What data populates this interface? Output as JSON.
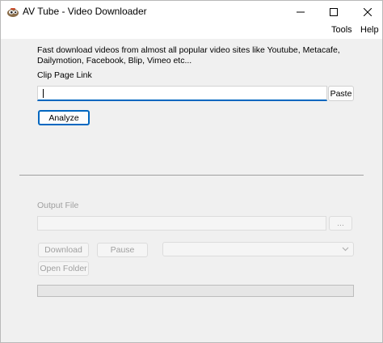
{
  "window": {
    "title": "AV Tube - Video Downloader",
    "controls": [
      "minimize-icon",
      "maximize-icon",
      "close-icon"
    ]
  },
  "menu": {
    "tools": "Tools",
    "help": "Help"
  },
  "main": {
    "description": "Fast download videos from almost all popular video sites like Youtube, Metacafe, Dailymotion, Facebook, Blip, Vimeo etc...",
    "clip_label": "Clip Page Link",
    "clip_value": "",
    "paste_label": "Paste",
    "analyze_label": "Analyze"
  },
  "output": {
    "label": "Output File",
    "value": "",
    "browse_label": "...",
    "download_label": "Download",
    "pause_label": "Pause",
    "format_selected": "",
    "open_folder_label": "Open Folder",
    "progress": 0
  },
  "colors": {
    "accent": "#0067c0",
    "disabled_text": "#a0a0a0"
  }
}
